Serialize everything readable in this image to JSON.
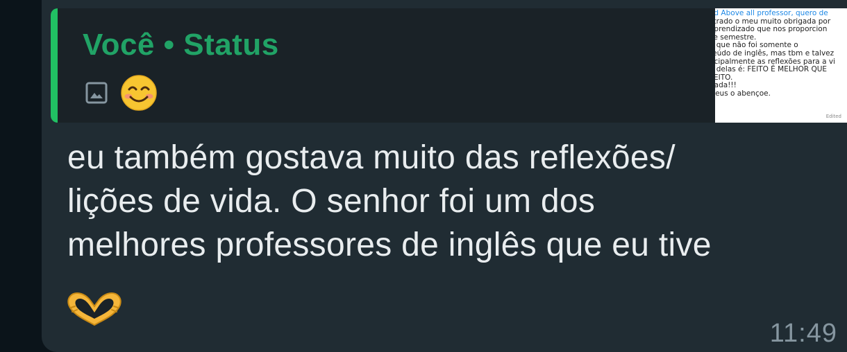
{
  "quoted_status": {
    "author": "Você • Status",
    "media_icon": "image-icon",
    "emoji": "smiling-face-emoji",
    "thumbnail_lines": [
      "od Above all professor, quero de",
      "strado o meu muito obrigada por",
      "aprendizado que nos proporcion",
      "se semestre.",
      "a que não foi somente o",
      "teúdo de inglês, mas tbm e talvez",
      "ncipalmente as reflexões para a vi",
      "a delas é: FEITO É MELHOR QUE",
      "FEITO.",
      "gada!!!",
      "Deus o abençoe."
    ],
    "thumbnail_edited": "Edited"
  },
  "message": {
    "lines": [
      "eu também gostava muito das reflexões/",
      "lições de vida. O senhor foi um dos",
      "melhores professores de inglês que eu tive"
    ],
    "emoji": "heart-hands-emoji",
    "time": "11:49"
  },
  "colors": {
    "background": "#0b141a",
    "bubble": "#202c33",
    "quote_background": "#1a2227",
    "quote_bar": "#21c063",
    "author": "#21a366",
    "message_text": "#e9edef",
    "time": "#8696a0"
  }
}
